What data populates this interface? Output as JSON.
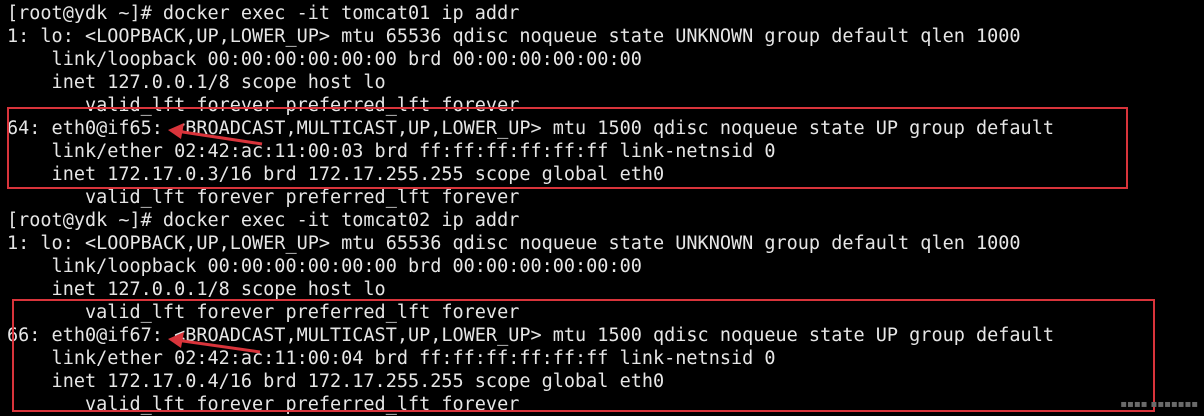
{
  "terminal": {
    "lines": [
      "[root@ydk ~]# docker exec -it tomcat01 ip addr",
      "1: lo: <LOOPBACK,UP,LOWER_UP> mtu 65536 qdisc noqueue state UNKNOWN group default qlen 1000",
      "    link/loopback 00:00:00:00:00:00 brd 00:00:00:00:00:00",
      "    inet 127.0.0.1/8 scope host lo",
      "       valid_lft forever preferred_lft forever",
      "64: eth0@if65: <BROADCAST,MULTICAST,UP,LOWER_UP> mtu 1500 qdisc noqueue state UP group default",
      "    link/ether 02:42:ac:11:00:03 brd ff:ff:ff:ff:ff:ff link-netnsid 0",
      "    inet 172.17.0.3/16 brd 172.17.255.255 scope global eth0",
      "       valid_lft forever preferred_lft forever",
      "[root@ydk ~]# docker exec -it tomcat02 ip addr",
      "1: lo: <LOOPBACK,UP,LOWER_UP> mtu 65536 qdisc noqueue state UNKNOWN group default qlen 1000",
      "    link/loopback 00:00:00:00:00:00 brd 00:00:00:00:00:00",
      "    inet 127.0.0.1/8 scope host lo",
      "       valid_lft forever preferred_lft forever",
      "66: eth0@if67: <BROADCAST,MULTICAST,UP,LOWER_UP> mtu 1500 qdisc noqueue state UP group default",
      "    link/ether 02:42:ac:11:00:04 brd ff:ff:ff:ff:ff:ff link-netnsid 0",
      "    inet 172.17.0.4/16 brd 172.17.255.255 scope global eth0",
      "       valid_lft forever preferred_lft forever"
    ],
    "watermark": "▪▪▪▪ ▪▪▪▪▪▪▪"
  },
  "colors": {
    "background": "#000000",
    "text": "#e6e6e6",
    "annotation": "#d9343b"
  }
}
